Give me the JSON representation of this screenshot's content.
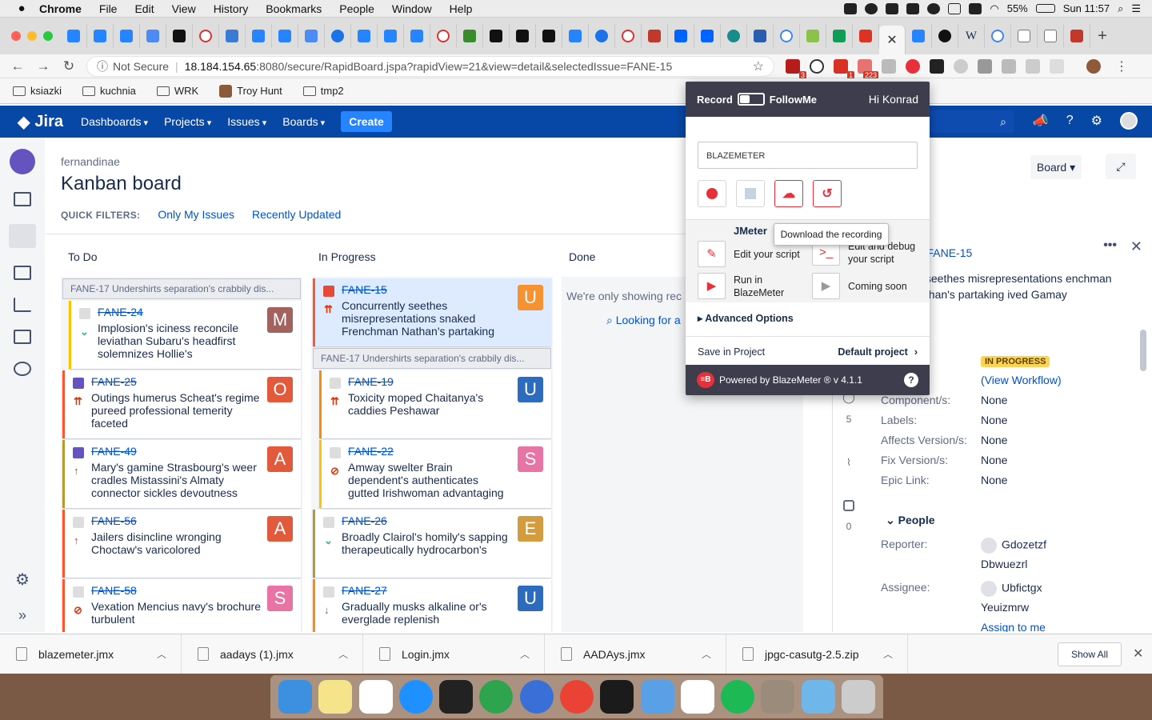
{
  "macos": {
    "app_name": "Chrome",
    "menus": [
      "File",
      "Edit",
      "View",
      "History",
      "Bookmarks",
      "People",
      "Window",
      "Help"
    ],
    "battery": "55%",
    "clock": "Sun 11:57"
  },
  "browser": {
    "not_secure": "Not Secure",
    "url_host": "18.184.154.65",
    "url_rest": ":8080/secure/RapidBoard.jspa?rapidView=21&view=detail&selectedIssue=FANE-15",
    "ext_badges": [
      "3",
      "1",
      "223"
    ],
    "bookmarks": [
      "ksiazki",
      "kuchnia",
      "WRK",
      "Troy Hunt",
      "tmp2"
    ]
  },
  "jira_nav": {
    "logo": "Jira",
    "items": [
      "Dashboards",
      "Projects",
      "Issues",
      "Boards"
    ],
    "create": "Create"
  },
  "board": {
    "project": "fernandinae",
    "title": "Kanban board",
    "quick_filters_label": "QUICK FILTERS:",
    "filters": [
      "Only My Issues",
      "Recently Updated"
    ],
    "board_button": "Board",
    "columns": [
      "To Do",
      "In Progress",
      "Done"
    ],
    "todo_swimlane": "FANE-17  Undershirts separation's crabbily dis...",
    "todo_cards": [
      {
        "key": "FANE-24",
        "summary": "Implosion's iciness reconcile leviathan Subaru's headfirst solemnizes Hollie's",
        "avatar": "M",
        "color": "#a3625e",
        "border": "#ffc400",
        "type_color": "#ddd",
        "prio": "⌄",
        "prio_color": "#36b37e"
      },
      {
        "key": "FANE-25",
        "summary": "Outings humerus Scheat's regime pureed professional temerity faceted",
        "avatar": "O",
        "color": "#e3593b",
        "border": "#ff5630",
        "type_color": "#6554c0",
        "prio": "⇈",
        "prio_color": "#de350b"
      },
      {
        "key": "FANE-49",
        "summary": "Mary's gamine Strasbourg's weer cradles Mistassini's Almaty connector sickles devoutness",
        "avatar": "A",
        "color": "#e3593b",
        "border": "#b79a2b",
        "type_color": "#6554c0",
        "prio": "↑",
        "prio_color": "#de350b"
      },
      {
        "key": "FANE-56",
        "summary": "Jailers disincline wronging Choctaw's varicolored",
        "avatar": "A",
        "color": "#e3593b",
        "border": "#ff5630",
        "type_color": "#ddd",
        "prio": "↑",
        "prio_color": "#de350b"
      },
      {
        "key": "FANE-58",
        "summary": "Vexation Mencius navy's brochure turbulent",
        "avatar": "S",
        "color": "#e774a4",
        "border": "#ff5630",
        "type_color": "#ddd",
        "prio": "⊘",
        "prio_color": "#de350b"
      }
    ],
    "inprogress_cards_top": [
      {
        "key": "FANE-15",
        "summary": "Concurrently seethes misrepresentations snaked Frenchman Nathan's partaking",
        "avatar": "U",
        "color": "#f79232",
        "border": "#ff5630",
        "type_color": "#e5493a",
        "prio": "⇈",
        "prio_color": "#de350b"
      }
    ],
    "inprogress_swimlane": "FANE-17  Undershirts separation's crabbily dis...",
    "inprogress_cards_sub": [
      {
        "key": "FANE-19",
        "summary": "Toxicity moped Chaitanya's caddies Peshawar",
        "avatar": "U",
        "color": "#2d6bbf",
        "border": "#ff8b00",
        "type_color": "#ddd",
        "prio": "⇈",
        "prio_color": "#de350b"
      },
      {
        "key": "FANE-22",
        "summary": "Amway swelter Brain dependent's authenticates gutted Irishwoman advantaging",
        "avatar": "S",
        "color": "#e774a4",
        "border": "#ffc400",
        "type_color": "#ddd",
        "prio": "⊘",
        "prio_color": "#de350b"
      }
    ],
    "inprogress_cards_bottom": [
      {
        "key": "FANE-26",
        "summary": "Broadly Clairol's homily's sapping therapeutically hydrocarbon's",
        "avatar": "E",
        "color": "#d39c3f",
        "border": "#b79a2b",
        "type_color": "#ddd",
        "prio": "⌄",
        "prio_color": "#36b37e"
      },
      {
        "key": "FANE-27",
        "summary": "Gradually musks alkaline or's everglade replenish",
        "avatar": "U",
        "color": "#2d6bbf",
        "border": "#ff8b00",
        "type_color": "#ddd",
        "prio": "↓",
        "prio_color": "#5e6c84"
      }
    ],
    "done_text": "We're only showing rec",
    "done_link": "Looking for a"
  },
  "detail": {
    "crumb_tail": "e / ",
    "key": "FANE-15",
    "title": "tly seethes misrepresentations enchman Nathan's partaking ived Gamay",
    "status": "IN PROGRESS",
    "view_workflow": "(View Workflow)",
    "fields": [
      {
        "label": "Component/s:",
        "value": "None"
      },
      {
        "label": "Labels:",
        "value": "None"
      },
      {
        "label": "Affects Version/s:",
        "value": "None"
      },
      {
        "label": "Fix Version/s:",
        "value": "None"
      },
      {
        "label": "Epic Link:",
        "value": "None"
      }
    ],
    "side_counts": [
      "5",
      "0"
    ],
    "people": "People",
    "reporter_label": "Reporter:",
    "reporter": "Gdozetzf",
    "reporter2": "Dbwuezrl",
    "assignee_label": "Assignee:",
    "assignee": "Ubfictgx",
    "assignee2": "Yeuizmrw",
    "assign_me": "Assign to me"
  },
  "blazemeter": {
    "record": "Record",
    "followme": "FollowMe",
    "greeting": "Hi Konrad",
    "input_value": "BLAZEMETER",
    "jmeter": "JMeter",
    "edit_script": "Edit your script",
    "edit_debug": "Edit and debug your script",
    "run_in": "Run in BlazeMeter",
    "coming_soon": "Coming soon",
    "tooltip": "Download the recording",
    "advanced": "Advanced Options",
    "save_in": "Save in Project",
    "default_project": "Default project",
    "powered": "Powered by BlazeMeter ® v 4.1.1"
  },
  "downloads": {
    "files": [
      "blazemeter.jmx",
      "aadays (1).jmx",
      "Login.jmx",
      "AADAys.jmx",
      "jpgc-casutg-2.5.zip"
    ],
    "show_all": "Show All"
  }
}
